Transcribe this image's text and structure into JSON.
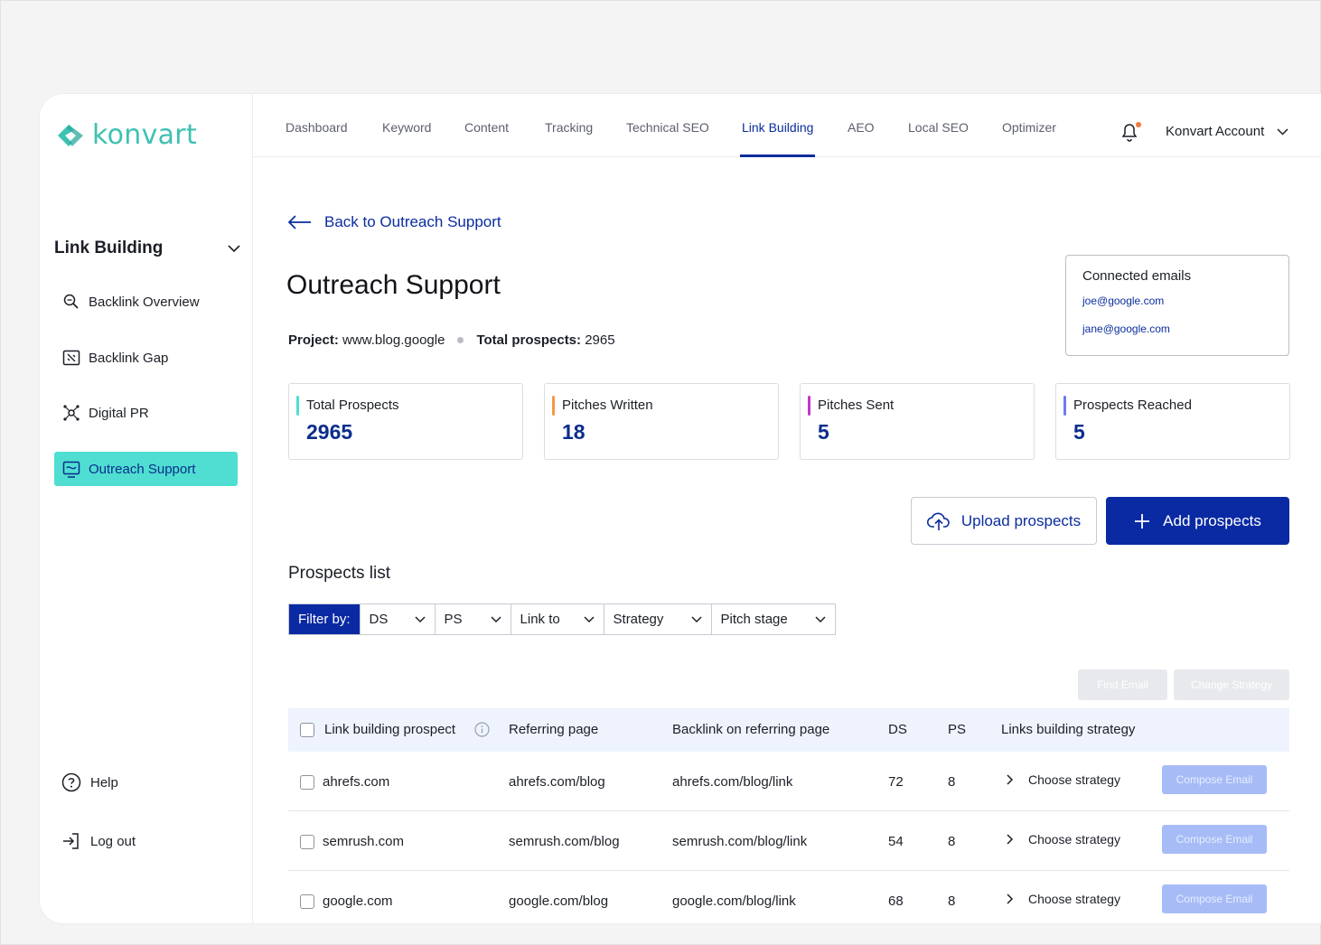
{
  "brand": {
    "name": "konvart",
    "color": "#3ec1b3"
  },
  "sidebar": {
    "section": "Link Building",
    "items": [
      {
        "label": "Backlink Overview",
        "icon": "search-link-icon"
      },
      {
        "label": "Backlink Gap",
        "icon": "gap-icon"
      },
      {
        "label": "Digital PR",
        "icon": "network-icon"
      },
      {
        "label": "Outreach Support",
        "icon": "outreach-icon",
        "active": true
      }
    ],
    "help": "Help",
    "logout": "Log out"
  },
  "topnav": {
    "tabs": [
      "Dashboard",
      "Keyword",
      "Content",
      "Tracking",
      "Technical SEO",
      "Link Building",
      "AEO",
      "Local SEO",
      "Optimizer"
    ],
    "active_tab": "Link Building",
    "account": "Konvart Account"
  },
  "main": {
    "back_label": "Back to Outreach Support",
    "title": "Outreach Support",
    "project_label": "Project:",
    "project_value": "www.blog.google",
    "prospects_label": "Total prospects:",
    "prospects_value": "2965",
    "connected": {
      "title": "Connected emails",
      "emails": [
        "joe@google.com",
        "jane@google.com"
      ]
    },
    "stats": [
      {
        "label": "Total Prospects",
        "value": "2965",
        "color": "#4fded1"
      },
      {
        "label": "Pitches Written",
        "value": "18",
        "color": "#f59a44"
      },
      {
        "label": "Pitches Sent",
        "value": "5",
        "color": "#c238c9"
      },
      {
        "label": "Prospects Reached",
        "value": "5",
        "color": "#6b7df0"
      }
    ],
    "upload_label": "Upload prospects",
    "add_label": "Add prospects",
    "list_title": "Prospects list",
    "filter_label": "Filter by:",
    "filters": [
      "DS",
      "PS",
      "Link to",
      "Strategy",
      "Pitch stage"
    ],
    "find_email": "Find Email",
    "change_strategy": "Change Strategy",
    "columns": [
      "Link building prospect",
      "Referring page",
      "Backlink on referring page",
      "DS",
      "PS",
      "Links building strategy"
    ],
    "rows": [
      {
        "prospect": "ahrefs.com",
        "referring": "ahrefs.com/blog",
        "backlink": "ahrefs.com/blog/link",
        "ds": "72",
        "ps": "8",
        "strategy": "Choose strategy",
        "action": "Compose Email"
      },
      {
        "prospect": "semrush.com",
        "referring": "semrush.com/blog",
        "backlink": "semrush.com/blog/link",
        "ds": "54",
        "ps": "8",
        "strategy": "Choose strategy",
        "action": "Compose Email"
      },
      {
        "prospect": "google.com",
        "referring": "google.com/blog",
        "backlink": "google.com/blog/link",
        "ds": "68",
        "ps": "8",
        "strategy": "Choose strategy",
        "action": "Compose Email"
      }
    ]
  }
}
